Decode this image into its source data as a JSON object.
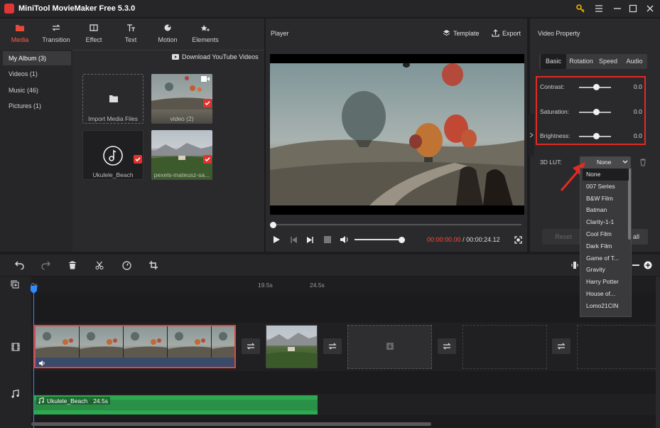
{
  "app": {
    "title": "MiniTool MovieMaker Free 5.3.0"
  },
  "toolbar": {
    "items": [
      {
        "label": "Media",
        "icon": "folder-icon"
      },
      {
        "label": "Transition",
        "icon": "swap-icon"
      },
      {
        "label": "Effect",
        "icon": "effect-icon"
      },
      {
        "label": "Text",
        "icon": "text-icon"
      },
      {
        "label": "Motion",
        "icon": "motion-icon"
      },
      {
        "label": "Elements",
        "icon": "elements-icon"
      }
    ]
  },
  "sidebar": {
    "items": [
      {
        "label": "My Album (3)"
      },
      {
        "label": "Videos (1)"
      },
      {
        "label": "Music (46)"
      },
      {
        "label": "Pictures (1)"
      }
    ]
  },
  "library": {
    "download_label": "Download YouTube Videos",
    "items": [
      {
        "label": "Import Media Files"
      },
      {
        "label": "video (2)"
      },
      {
        "label": "Ukulele_Beach"
      },
      {
        "label": "pexels-mateusz-sa..."
      }
    ]
  },
  "player": {
    "title": "Player",
    "template_label": "Template",
    "export_label": "Export",
    "current_time": "00:00:00.00",
    "separator": "/",
    "total_time": "00:00:24.12",
    "progress": 0.0,
    "volume": 1.0
  },
  "property": {
    "title": "Video Property",
    "tabs": [
      {
        "label": "Basic"
      },
      {
        "label": "Rotation"
      },
      {
        "label": "Speed"
      },
      {
        "label": "Audio"
      }
    ],
    "contrast": {
      "label": "Contrast:",
      "value": "0.0"
    },
    "saturation": {
      "label": "Saturation:",
      "value": "0.0"
    },
    "brightness": {
      "label": "Brightness:",
      "value": "0.0"
    },
    "lut": {
      "label": "3D LUT:",
      "selected": "None",
      "options": [
        "None",
        "007 Series",
        "B&W Film",
        "Batman",
        "Clarity-1-1",
        "Cool Film",
        "Dark Film",
        "Game of T...",
        "Gravity",
        "Harry Potter",
        "House of...",
        "Lomo21CIN"
      ]
    },
    "reset_label": "Reset",
    "apply_all_label": "all"
  },
  "timeline": {
    "ruler": [
      "0s",
      "19.5s",
      "24.5s"
    ],
    "audio_clip": {
      "name": "Ukulele_Beach",
      "duration": "24.5s"
    }
  },
  "colors": {
    "accent": "#e0332f",
    "audio": "#2fa84f",
    "playhead": "#2f8cff"
  }
}
